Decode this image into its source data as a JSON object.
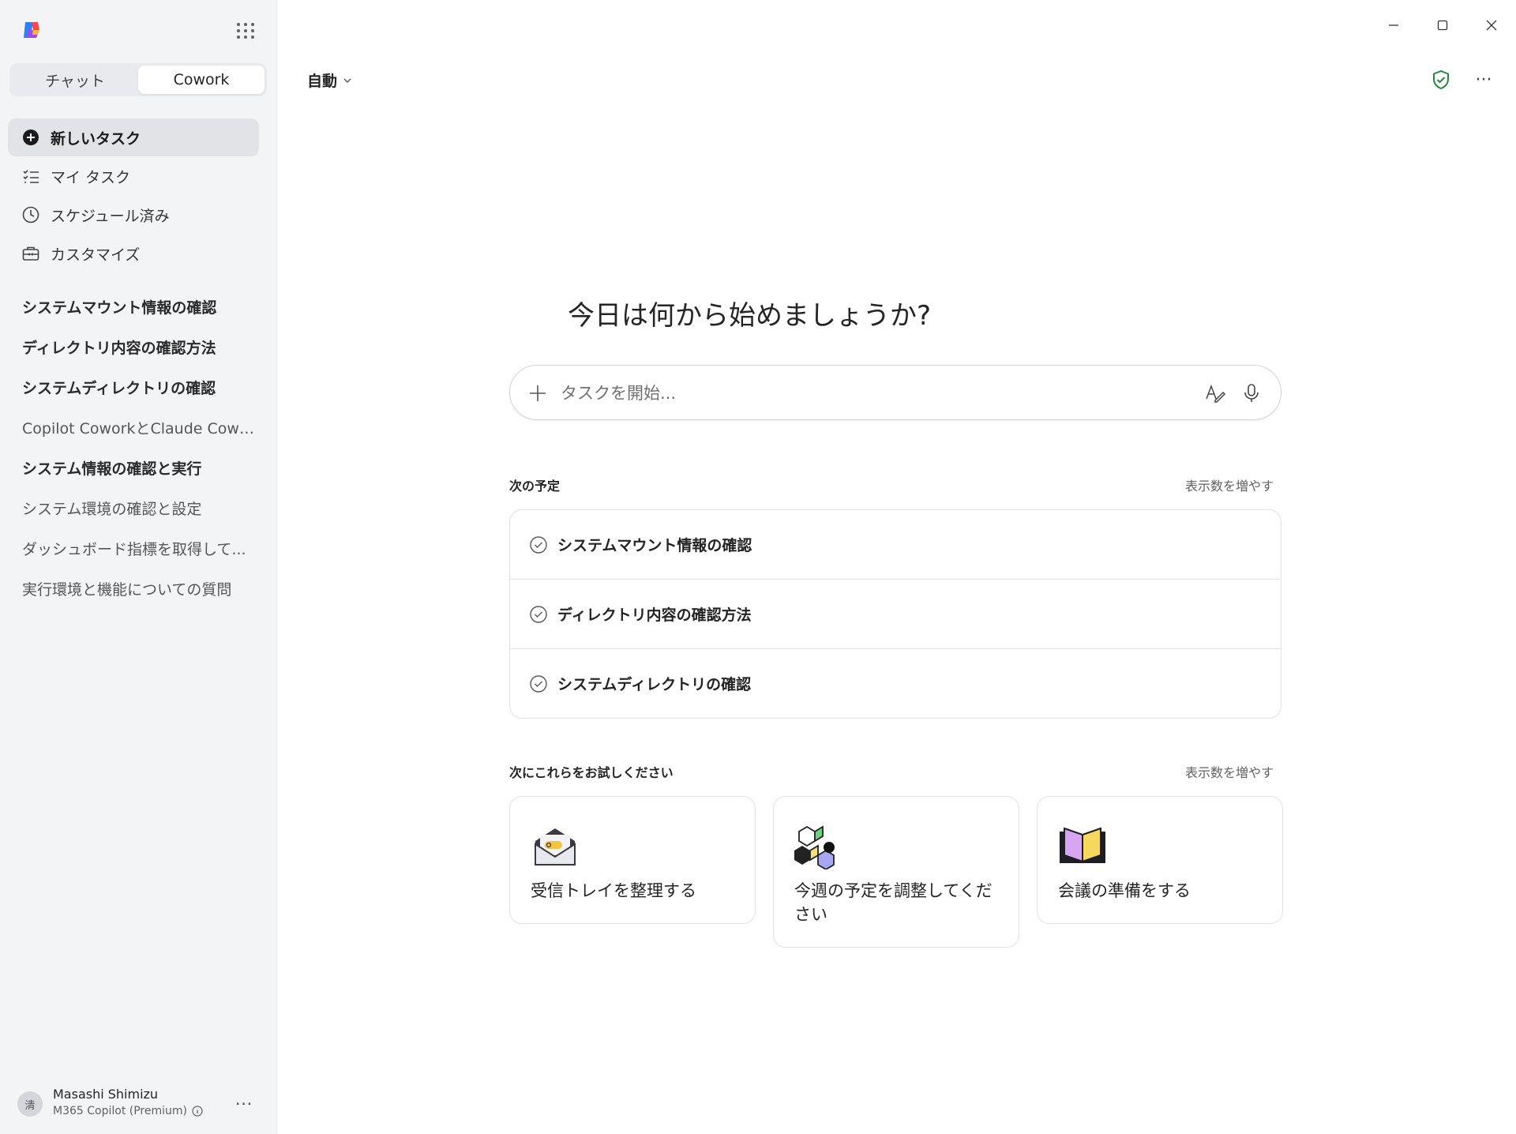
{
  "sidebar": {
    "mode_tabs": [
      "チャット",
      "Cowork"
    ],
    "nav": [
      {
        "label": "新しいタスク",
        "icon": "plus-circle-icon"
      },
      {
        "label": "マイ タスク",
        "icon": "task-list-icon"
      },
      {
        "label": "スケジュール済み",
        "icon": "clock-icon"
      },
      {
        "label": "カスタマイズ",
        "icon": "toolbox-icon"
      }
    ],
    "history": [
      "システムマウント情報の確認",
      "ディレクトリ内容の確認方法",
      "システムディレクトリの確認",
      "Copilot CoworkとClaude Cowor...",
      "システム情報の確認と実行",
      "システム環境の確認と設定",
      "ダッシュボード指標を取得して...",
      "実行環境と機能についての質問"
    ],
    "profile": {
      "initial": "清",
      "name": "Masashi Shimizu",
      "plan": "M365 Copilot (Premium)"
    }
  },
  "header": {
    "model": "自動"
  },
  "main": {
    "greeting": "今日は何から始めましょうか?",
    "input_placeholder": "タスクを開始...",
    "upcoming_title": "次の予定",
    "more_label": "表示数を増やす",
    "upcoming": [
      "システムマウント情報の確認",
      "ディレクトリ内容の確認方法",
      "システムディレクトリの確認"
    ],
    "suggest_title": "次にこれらをお試しください",
    "suggestions": [
      {
        "label": "受信トレイを整理する",
        "icon": "envelope-icon"
      },
      {
        "label": "今週の予定を調整してください",
        "icon": "cubes-icon"
      },
      {
        "label": "会議の準備をする",
        "icon": "book-icon"
      }
    ]
  },
  "colors": {
    "sidebar_bg": "#f3f4f6",
    "shield_green": "#1f8a3b",
    "card_border": "#e1e1e1"
  }
}
